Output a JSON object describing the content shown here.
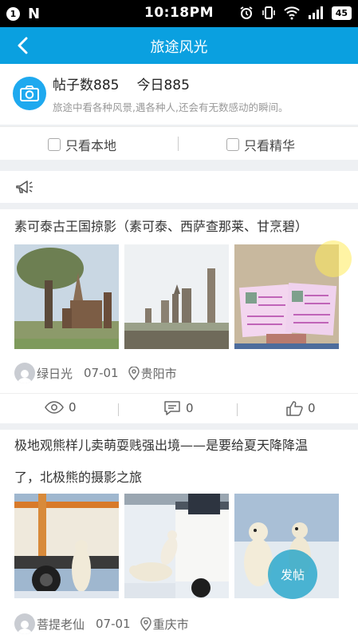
{
  "status_bar": {
    "notification_badge": "1",
    "notification_glyph": "N",
    "time": "10:18PM",
    "battery": "45"
  },
  "app_bar": {
    "title": "旅途风光"
  },
  "forum": {
    "post_count": "帖子数885",
    "today_count": "今日885",
    "description": "旅途中看各种风景,遇各种人,还会有无数感动的瞬间。"
  },
  "filters": {
    "local_only": "只看本地",
    "featured_only": "只看精华"
  },
  "posts": [
    {
      "title": "素可泰古王国掠影（素可泰、西萨查那莱、甘烹碧）",
      "author": "绿日光",
      "date": "07-01",
      "location": "贵阳市",
      "views": "0",
      "comments": "0",
      "likes": "0"
    },
    {
      "title_line1": "极地观熊样儿卖萌耍贱强出境——是要给夏天降降温",
      "title_line2": "了，北极熊的摄影之旅",
      "author": "菩提老仙",
      "date": "07-01",
      "location": "重庆市"
    }
  ],
  "fab": {
    "label": "发帖"
  },
  "colors": {
    "accent": "#0aa0e0",
    "background": "#eef0f3"
  }
}
